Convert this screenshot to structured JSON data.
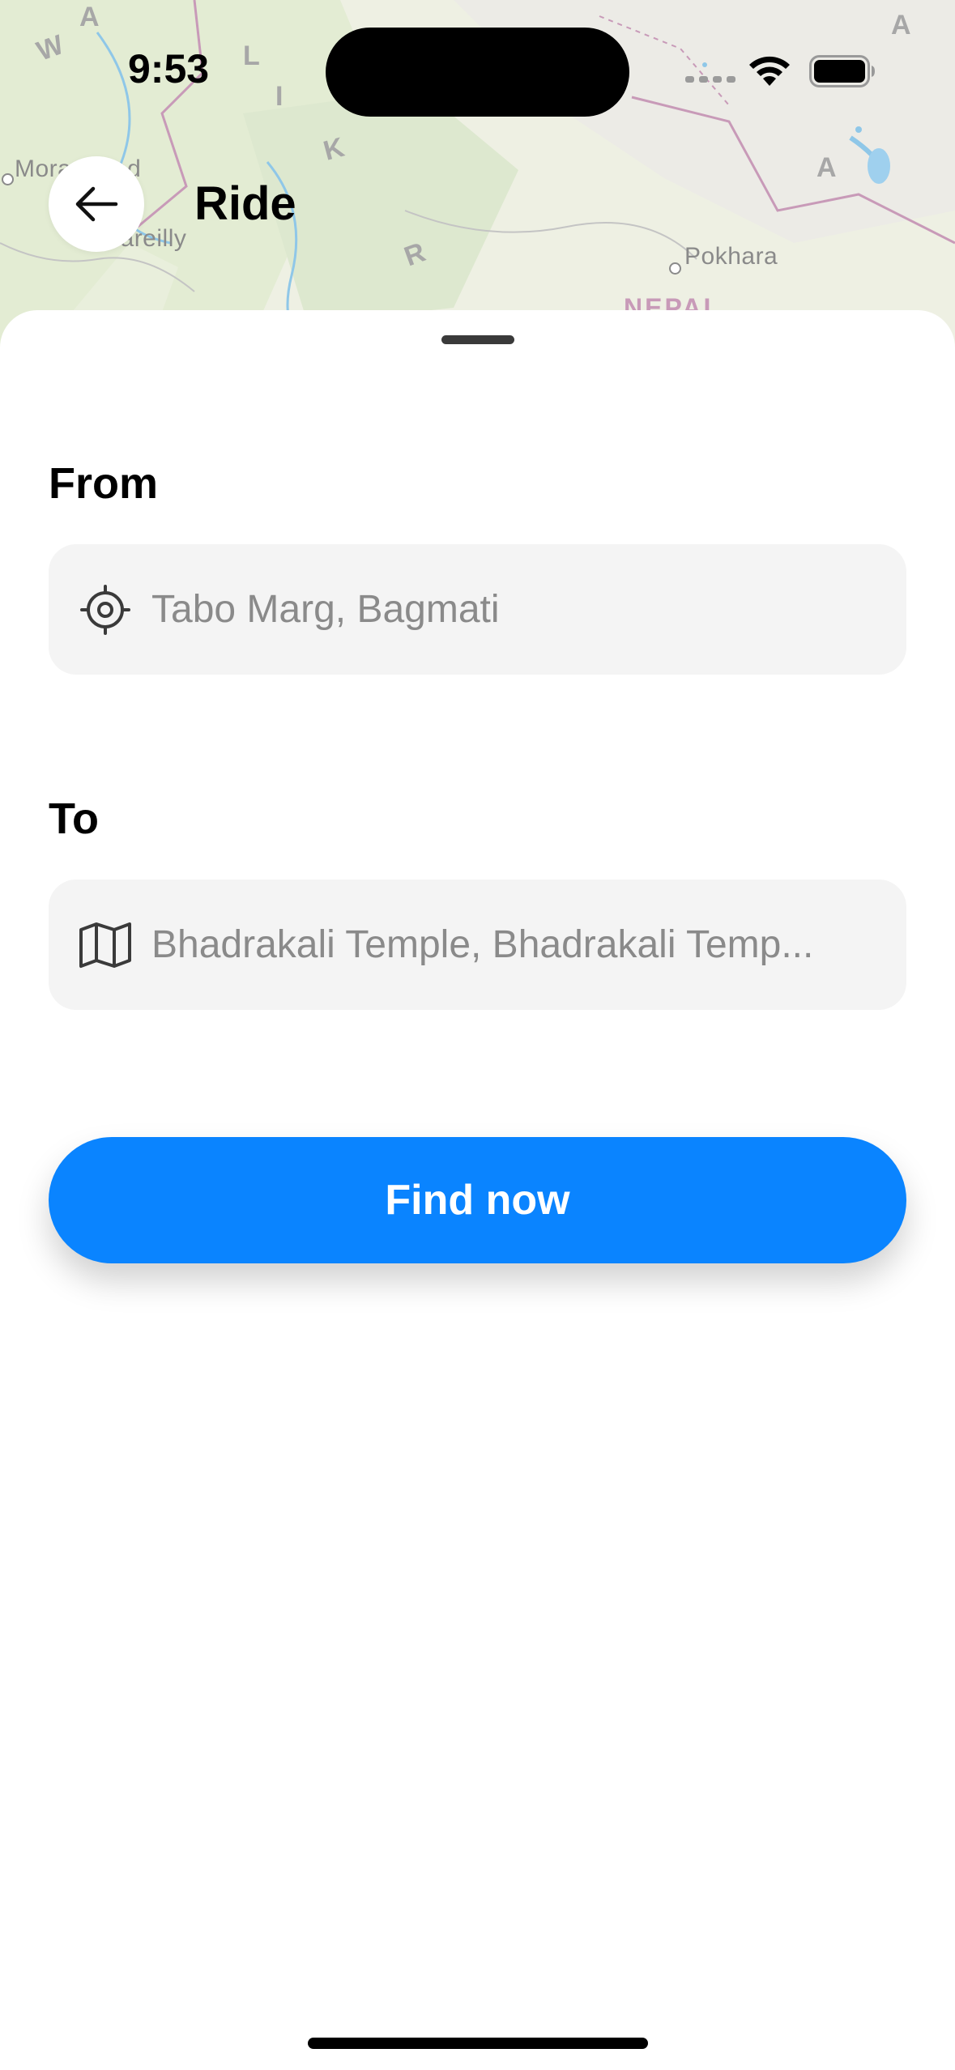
{
  "status_bar": {
    "time": "9:53",
    "wifi_icon": "wifi-icon",
    "battery_icon": "battery-icon"
  },
  "map": {
    "places": [
      "Moradabad",
      "Bareilly",
      "Pokhara"
    ],
    "region_letters": [
      "W",
      "A",
      "L",
      "I",
      "K",
      "R",
      "A",
      "A"
    ],
    "country": "NEPAL"
  },
  "header": {
    "back_icon": "arrow-left-icon",
    "title": "Ride"
  },
  "form": {
    "from": {
      "label": "From",
      "icon": "target-location-icon",
      "value": "Tabo Marg, Bagmati"
    },
    "to": {
      "label": "To",
      "icon": "map-icon",
      "value": "Bhadrakali Temple, Bhadrakali Temp..."
    },
    "submit_label": "Find now"
  },
  "colors": {
    "accent": "#0a84ff",
    "field_bg": "#f4f4f4",
    "field_text": "#8a8a8a",
    "map_bg": "#eef0e3",
    "map_border": "#c89ab8"
  }
}
